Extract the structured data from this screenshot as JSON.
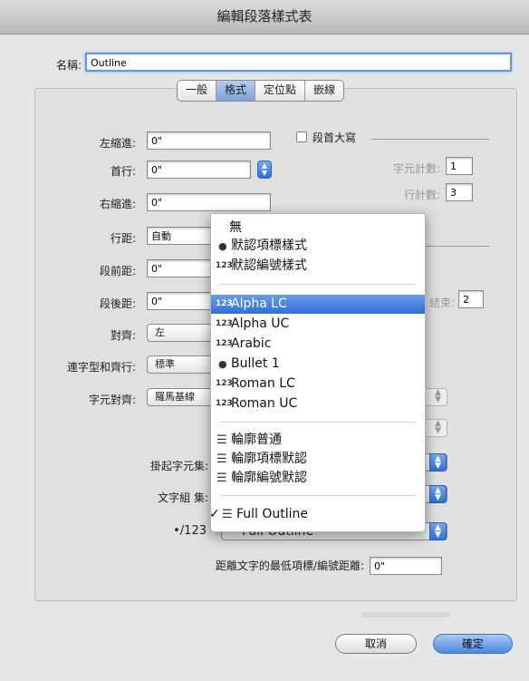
{
  "window": {
    "title": "編輯段落樣式表"
  },
  "name_field": {
    "label": "名稱:",
    "value": "Outline"
  },
  "tabs": [
    {
      "label": "一般",
      "active": false
    },
    {
      "label": "格式",
      "active": true
    },
    {
      "label": "定位點",
      "active": false
    },
    {
      "label": "嵌線",
      "active": false
    }
  ],
  "format": {
    "left_indent": {
      "label": "左縮進:",
      "value": "0\""
    },
    "first_line": {
      "label": "首行:",
      "value": "0\""
    },
    "right_indent": {
      "label": "右縮進:",
      "value": "0\""
    },
    "leading": {
      "label": "行距:",
      "value": "自動"
    },
    "space_before": {
      "label": "段前距:",
      "value": "0\""
    },
    "space_after": {
      "label": "段後距:",
      "value": "0\""
    },
    "alignment": {
      "label": "對齊:",
      "value": "左"
    },
    "hyphenation": {
      "label": "連字型和齊行:",
      "value": "標準"
    },
    "char_align": {
      "label": "字元對齊:",
      "value": "羅馬基線"
    },
    "hanging_charset": {
      "label": "掛起字元集:"
    },
    "char_group": {
      "label": "文字組 集:"
    },
    "bullet_numbering": {
      "label": "•/123",
      "value": "Full Outline"
    },
    "min_distance": {
      "label": "距離文字的最低項標/編號距離:",
      "value": "0\""
    }
  },
  "drop_caps": {
    "label": "段首大寫",
    "checked": false,
    "char_count": {
      "label": "字元計數:",
      "value": "1"
    },
    "line_count": {
      "label": "行計數:",
      "value": "3"
    }
  },
  "partial": {
    "end_label": "結束:",
    "end_value": "2"
  },
  "menu": {
    "items": [
      {
        "label": "無",
        "icon": "",
        "selected": false,
        "checked": false
      },
      {
        "label": "默認項標樣式",
        "icon": "●",
        "selected": false,
        "checked": false
      },
      {
        "label": "默認編號樣式",
        "icon": "123",
        "selected": false,
        "checked": false
      },
      {
        "label": "Alpha LC",
        "icon": "123",
        "selected": true,
        "checked": false
      },
      {
        "label": "Alpha UC",
        "icon": "123",
        "selected": false,
        "checked": false
      },
      {
        "label": "Arabic",
        "icon": "123",
        "selected": false,
        "checked": false
      },
      {
        "label": "Bullet 1",
        "icon": "●",
        "selected": false,
        "checked": false
      },
      {
        "label": "Roman LC",
        "icon": "123",
        "selected": false,
        "checked": false
      },
      {
        "label": "Roman UC",
        "icon": "123",
        "selected": false,
        "checked": false
      },
      {
        "label": "輪廓普通",
        "icon": "☰",
        "selected": false,
        "checked": false
      },
      {
        "label": "輪廓項標默認",
        "icon": "☰",
        "selected": false,
        "checked": false
      },
      {
        "label": "輪廓編號默認",
        "icon": "☰",
        "selected": false,
        "checked": false
      },
      {
        "label": "Full Outline",
        "icon": "☰",
        "selected": false,
        "checked": true
      }
    ]
  },
  "buttons": {
    "cancel": "取消",
    "ok": "確定"
  }
}
